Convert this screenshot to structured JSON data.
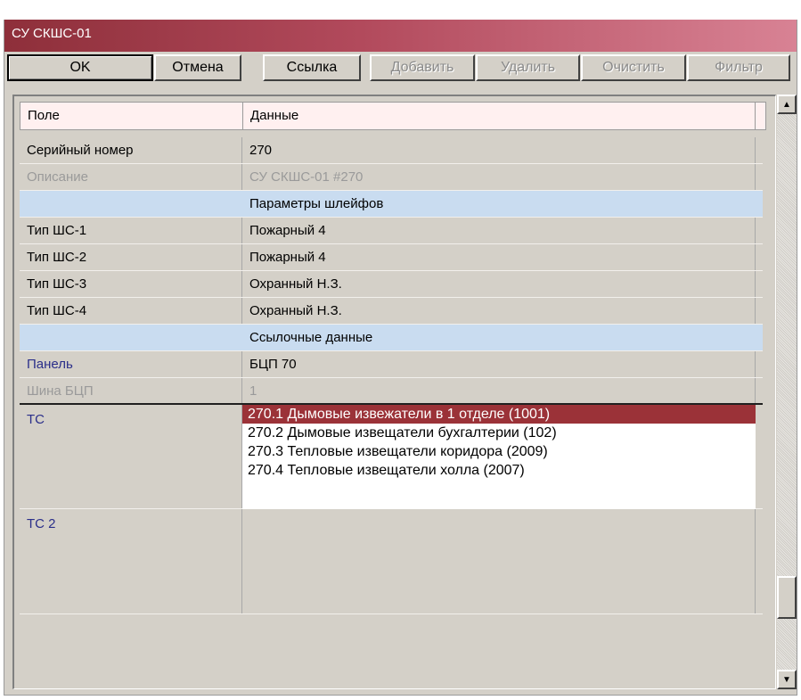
{
  "window": {
    "title": "СУ СКШС-01"
  },
  "toolbar": {
    "buttons": [
      {
        "label": "OK",
        "enabled": true
      },
      {
        "label": "Отмена",
        "enabled": true
      },
      {
        "label": "Ссылка",
        "enabled": true
      },
      {
        "label": "Добавить",
        "enabled": false
      },
      {
        "label": "Удалить",
        "enabled": false
      },
      {
        "label": "Очистить",
        "enabled": false
      },
      {
        "label": "Фильтр",
        "enabled": false
      }
    ]
  },
  "grid": {
    "columns": [
      "Поле",
      "Данные"
    ],
    "rows": [
      {
        "field": "Серийный номер",
        "value": "270"
      },
      {
        "field": "Описание",
        "value": "СУ СКШС-01 #270"
      },
      {
        "section": "Параметры шлейфов"
      },
      {
        "field": "Тип ШС-1",
        "value": "Пожарный 4"
      },
      {
        "field": "Тип ШС-2",
        "value": "Пожарный 4"
      },
      {
        "field": "Тип ШС-3",
        "value": "Охранный Н.З."
      },
      {
        "field": "Тип ШС-4",
        "value": "Охранный Н.З."
      },
      {
        "section": "Ссылочные данные"
      },
      {
        "field": "Панель",
        "value": "БЦП 70"
      },
      {
        "field": "Шина БЦП",
        "value": "1"
      },
      {
        "field": "ТС",
        "list": [
          "270.1 Дымовые извежатели в 1 отделе (1001)",
          "270.2 Дымовые извещатели бухгалтерии (102)",
          "270.3 Тепловые извещатели коридора (2009)",
          "270.4 Тепловые извещатели холла (2007)"
        ],
        "selected_index": 0
      },
      {
        "field": "ТС 2",
        "value": ""
      }
    ]
  },
  "icons": {
    "scroll_up": "arrow-up-icon",
    "scroll_down": "arrow-down-icon"
  },
  "colors": {
    "title_gradient_start": "#8e2f3a",
    "title_gradient_end": "#d88294",
    "selection": "#9b3238",
    "section": "#c9dcf0"
  }
}
